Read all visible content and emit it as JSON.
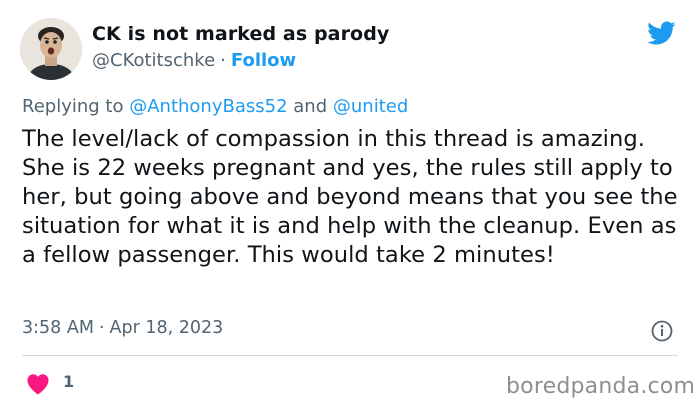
{
  "author": {
    "display_name": "CK is not marked as parody",
    "handle": "@CKotitschke",
    "separator": "·",
    "follow_label": "Follow"
  },
  "reply_context": {
    "prefix": "Replying to",
    "first_mention": "@AnthonyBass52",
    "conjunction": "and",
    "second_mention": "@united"
  },
  "tweet": {
    "text": "The level/lack of compassion in this thread is amazing. She is 22 weeks pregnant and yes, the rules still apply to her, but going above and beyond means that you see the situation for what it is and help with the cleanup. Even as a fellow passenger. This would take 2 minutes!",
    "time": "3:58 AM",
    "separator": "·",
    "date": "Apr 18, 2023"
  },
  "engagement": {
    "like_count": "1"
  },
  "watermark": "boredpanda.com",
  "icons": {
    "brand": "twitter-bird-icon",
    "info": "info-icon",
    "like": "heart-icon"
  },
  "colors": {
    "accent": "#1d9bf0",
    "like": "#f91880",
    "secondary_text": "#536471",
    "primary_text": "#0f1419",
    "divider": "#cfd9de"
  }
}
